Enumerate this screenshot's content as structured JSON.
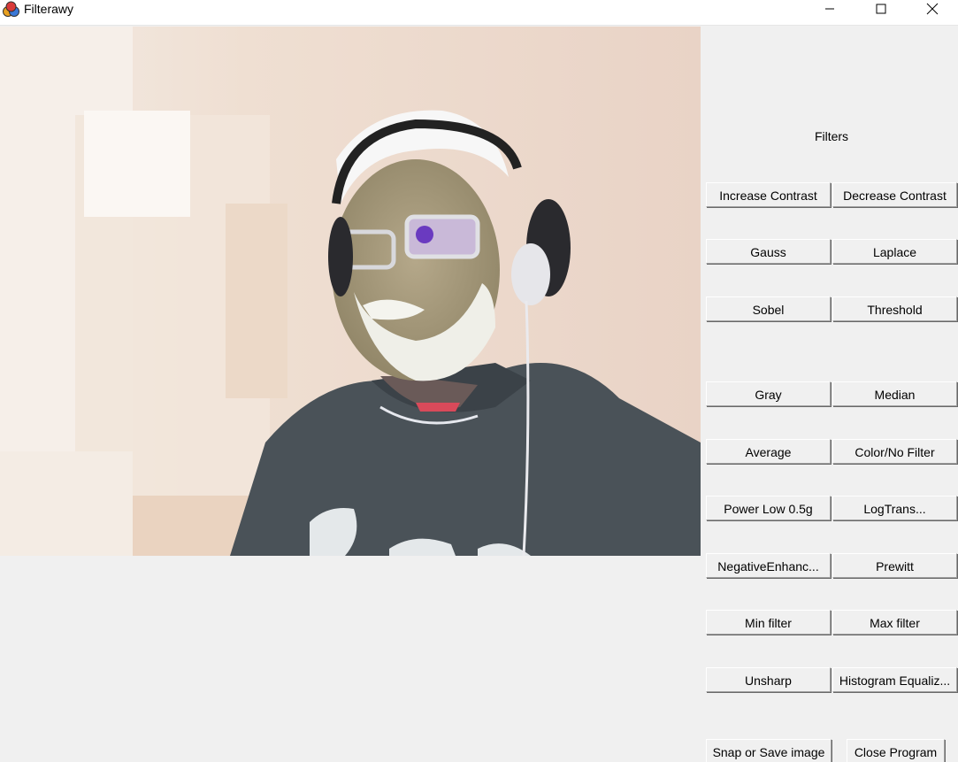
{
  "window": {
    "title": "Filterawy",
    "app_icon": "colored-circles-icon",
    "controls": {
      "minimize_icon": "minimize-icon",
      "maximize_icon": "maximize-icon",
      "close_icon": "close-icon"
    }
  },
  "camera": {
    "description_icon": "webcam-feed-image"
  },
  "filters_panel": {
    "heading": "Filters",
    "buttons": [
      {
        "left": "Increase Contrast",
        "right": "Decrease Contrast"
      },
      {
        "left": "Gauss",
        "right": "Laplace"
      },
      {
        "left": "Sobel",
        "right": "Threshold"
      },
      {
        "left": "Gray",
        "right": "Median"
      },
      {
        "left": "Average",
        "right": "Color/No Filter"
      },
      {
        "left": "Power Low 0.5g",
        "right": "LogTrans..."
      },
      {
        "left": "NegativeEnhanc...",
        "right": "Prewitt"
      },
      {
        "left": "Min filter",
        "right": "Max filter"
      },
      {
        "left": "Unsharp",
        "right": "Histogram Equaliz..."
      }
    ],
    "snap_label": "Snap or Save image",
    "close_label": "Close Program"
  }
}
